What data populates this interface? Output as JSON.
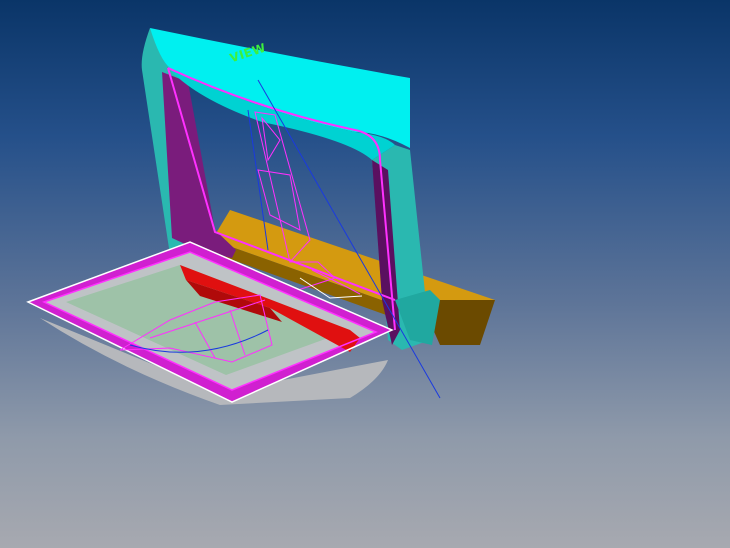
{
  "viewport": {
    "view_label": "VIEW"
  },
  "colors": {
    "frame_top": "#00f0f0",
    "frame_side": "#2ab8b0",
    "interior_purple": "#7a1c7c",
    "tray_rim": "#d020d0",
    "tray_surface": "#bfc3c6",
    "tray_inner": "#9ec2a8",
    "tray_wall_red": "#e01010",
    "base_orange": "#d49a10",
    "wireframe_blue": "#1a3adf",
    "wireframe_magenta": "#ff30ff",
    "label_green": "#3df03d"
  }
}
